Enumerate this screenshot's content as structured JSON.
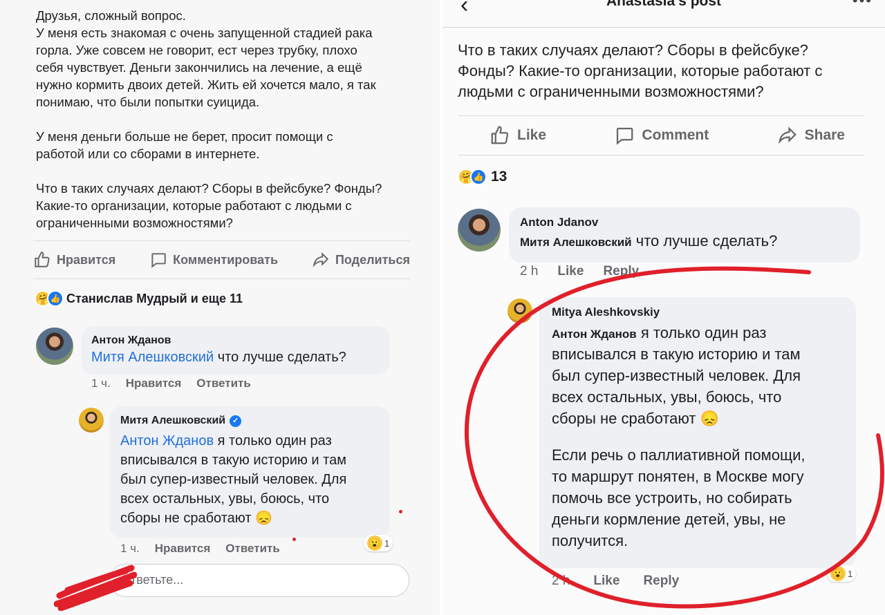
{
  "left": {
    "post": {
      "paragraphs": [
        [
          "Друзья, сложный вопрос.",
          "У меня есть знакомая с очень запущенной стадией рака",
          "горла. Уже совсем не говорит, ест через трубку, плохо",
          "себя чувствует. Деньги закончились на лечение, а ещё",
          "нужно кормить двоих детей. Жить ей хочется мало, я так",
          "понимаю, что были попытки суицида."
        ],
        [
          "У меня деньги больше не берет, просит помощи с",
          "работой или со сборами в интернете."
        ],
        [
          "Что в таких случаях делают? Сборы в фейсбуке? Фонды?",
          "Какие-то организации, которые работают с людьми с",
          "ограниченными возможностями?"
        ]
      ]
    },
    "actions": {
      "like": "Нравится",
      "comment": "Комментировать",
      "share": "Поделиться"
    },
    "reactions_text": "Станислав Мудрый и еще 11",
    "comment1": {
      "author": "Антон Жданов",
      "mention": "Митя Алешковский",
      "text": " что лучше сделать?",
      "time": "1 ч.",
      "like": "Нравится",
      "reply": "Ответить"
    },
    "comment2": {
      "author": "Митя Алешковский",
      "mention": "Антон Жданов",
      "lines": [
        " я только один раз",
        "вписывался в такую историю и там",
        "был супер-известный человек. Для",
        "всех остальных, увы, боюсь, что",
        "сборы не сработают 😞"
      ],
      "time": "1 ч.",
      "like": "Нравится",
      "reply": "Ответить",
      "reaction_count": "1"
    },
    "reply_placeholder": "Ответьте..."
  },
  "right": {
    "header_title": "Anastasia's post",
    "post_lines": [
      "Что в таких случаях делают? Сборы в фейсбуке?",
      "Фонды? Какие-то организации, которые работают с",
      "людьми с ограниченными возможностями?"
    ],
    "actions": {
      "like": "Like",
      "comment": "Comment",
      "share": "Share"
    },
    "reactions_count": "13",
    "comment1": {
      "author": "Anton Jdanov",
      "mention": "Митя Алешковский",
      "text": " что лучше сделать?",
      "time": "2 h",
      "like": "Like",
      "reply": "Reply"
    },
    "comment2": {
      "author": "Mitya Aleshkovskiy",
      "mention": "Антон Жданов",
      "para1": [
        " я только один раз",
        "вписывался в такую историю и там",
        "был супер-известный человек. Для",
        "всех остальных, увы, боюсь, что",
        "сборы не сработают 😞"
      ],
      "para2": [
        "Если речь о паллиативной помощи,",
        "то маршрут понятен, в Москве могу",
        "помочь все устроить, но собирать",
        "деньги кормление детей, увы, не",
        "получится."
      ],
      "time": "2 h",
      "like": "Like",
      "reply": "Reply",
      "reaction_count": "1"
    }
  },
  "colors": {
    "mention": "#216fdb",
    "annotation_red": "#e0202a",
    "like_blue": "#1877f2"
  }
}
